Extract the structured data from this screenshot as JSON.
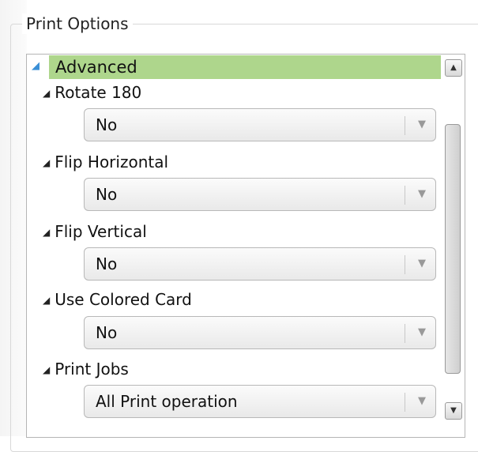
{
  "group": {
    "title": "Print Options"
  },
  "category": {
    "label": "Advanced",
    "expander_icon": "expand-triangle-icon"
  },
  "properties": [
    {
      "label": "Rotate 180",
      "value": "No"
    },
    {
      "label": "Flip Horizontal",
      "value": "No"
    },
    {
      "label": "Flip Vertical",
      "value": "No"
    },
    {
      "label": "Use Colored Card",
      "value": "No"
    },
    {
      "label": "Print Jobs",
      "value": "All Print operation"
    }
  ],
  "colors": {
    "category_band": "#aed68c"
  }
}
